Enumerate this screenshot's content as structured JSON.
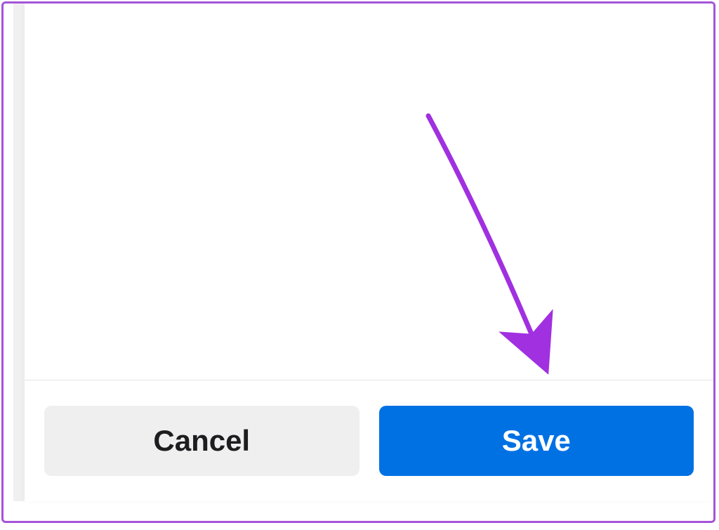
{
  "footer": {
    "cancel_label": "Cancel",
    "save_label": "Save"
  },
  "colors": {
    "frame_border": "#a454d8",
    "arrow": "#a030e0",
    "primary_button": "#0071e3",
    "secondary_button": "#efeff0"
  }
}
